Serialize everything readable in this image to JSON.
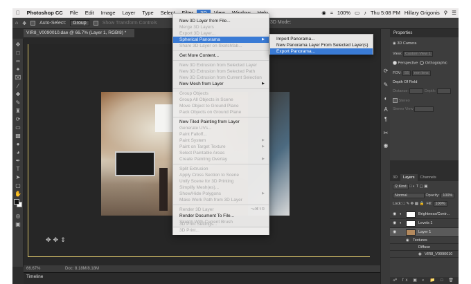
{
  "menubar": {
    "items": [
      "Photoshop CC",
      "File",
      "Edit",
      "Image",
      "Layer",
      "Type",
      "Select",
      "Filter",
      "3D",
      "View",
      "Window",
      "Help"
    ],
    "battery": "100%",
    "time": "Thu 5:08 PM",
    "user": "Hillary Grigonis"
  },
  "options_bar": {
    "auto_select_label": "Auto-Select:",
    "auto_select_value": "Group",
    "show_transform": "Show Transform Controls",
    "mode_3d_label": "3D Mode:"
  },
  "document": {
    "tab_title": "VIR8_V0090010.dae @ 66.7% (Layer 1, RGB/8) *",
    "zoom": "66.67%",
    "doc_size": "Doc: 8.18M/8.18M"
  },
  "timeline": {
    "label": "Timeline"
  },
  "menu_3d": {
    "items": [
      {
        "label": "New 3D Layer from File...",
        "enabled": true
      },
      {
        "label": "Merge 3D Layers",
        "enabled": false
      },
      {
        "label": "Export 3D Layer...",
        "enabled": false
      },
      {
        "label": "Spherical Panorama",
        "enabled": true,
        "submenu": true,
        "highlighted": true
      },
      {
        "label": "Share 3D Layer on Sketchfab...",
        "enabled": false
      },
      {
        "label": "Get More Content...",
        "enabled": true
      },
      {
        "label": "New 3D Extrusion from Selected Layer",
        "enabled": false
      },
      {
        "label": "New 3D Extrusion from Selected Path",
        "enabled": false
      },
      {
        "label": "New 3D Extrusion from Current Selection",
        "enabled": false
      },
      {
        "label": "New Mesh from Layer",
        "enabled": true,
        "submenu": true
      },
      {
        "label": "Group Objects",
        "enabled": false
      },
      {
        "label": "Group All Objects in Scene",
        "enabled": false
      },
      {
        "label": "Move Object to Ground Plane",
        "enabled": false
      },
      {
        "label": "Pack Objects on Ground Plane",
        "enabled": false
      },
      {
        "label": "New Tiled Painting from Layer",
        "enabled": true
      },
      {
        "label": "Generate UVs...",
        "enabled": false
      },
      {
        "label": "Paint Falloff...",
        "enabled": false
      },
      {
        "label": "Paint System",
        "enabled": false,
        "submenu": true
      },
      {
        "label": "Paint on Target Texture",
        "enabled": false,
        "submenu": true
      },
      {
        "label": "Select Paintable Areas",
        "enabled": false
      },
      {
        "label": "Create Painting Overlay",
        "enabled": false,
        "submenu": true
      },
      {
        "label": "Split Extrusion",
        "enabled": false
      },
      {
        "label": "Apply Cross Section to Scene",
        "enabled": false
      },
      {
        "label": "Unify Scene for 3D Printing",
        "enabled": false
      },
      {
        "label": "Simplify Mesh(es)...",
        "enabled": false
      },
      {
        "label": "Show/Hide Polygons",
        "enabled": false,
        "submenu": true
      },
      {
        "label": "Make Work Path from 3D Layer",
        "enabled": false
      },
      {
        "label": "Render 3D Layer",
        "enabled": false,
        "shortcut": "⌥⌘⇧R"
      },
      {
        "label": "Render Document To File...",
        "enabled": true
      },
      {
        "label": "Sketch With Current Brush",
        "enabled": false
      },
      {
        "label": "3D Print Settings...",
        "enabled": false
      },
      {
        "label": "3D Print...",
        "enabled": false
      }
    ]
  },
  "submenu_panorama": {
    "items": [
      {
        "label": "Import Panorama...",
        "highlighted": false
      },
      {
        "label": "New Panorama Layer From Selected Layer(s)",
        "highlighted": false
      },
      {
        "label": "Export Panorama...",
        "highlighted": true
      }
    ]
  },
  "properties": {
    "tab": "Properties",
    "title": "3D Camera",
    "view_label": "View:",
    "view_value": "Custom View 1",
    "perspective": "Perspective",
    "orthographic": "Orthographic",
    "fov_label": "FOV:",
    "fov_value": "55",
    "fov_unit": "mm lens",
    "depth_of_field": "Depth Of Field",
    "distance": "Distance:",
    "depth": "Depth:",
    "stereo": "Stereo",
    "stereo_view": "Stereo View"
  },
  "layers": {
    "tabs": [
      "3D",
      "Layers",
      "Channels"
    ],
    "kind": "Kind",
    "blend": "Normal",
    "opacity_label": "Opacity:",
    "opacity_value": "100%",
    "lock_label": "Lock:",
    "fill_label": "Fill:",
    "fill_value": "100%",
    "rows": [
      {
        "name": "Brightness/Contr..."
      },
      {
        "name": "Levels 1"
      },
      {
        "name": "Layer 1"
      },
      {
        "name": "Textures"
      },
      {
        "name": "Diffuse"
      },
      {
        "name": "VIR8_V0090010"
      }
    ]
  }
}
